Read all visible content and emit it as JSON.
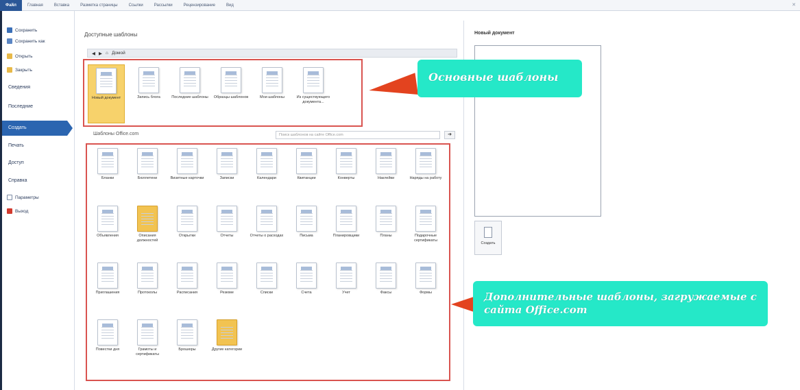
{
  "ribbon": {
    "tabs": [
      "Файл",
      "Главная",
      "Вставка",
      "Разметка страницы",
      "Ссылки",
      "Рассылки",
      "Рецензирование",
      "Вид"
    ]
  },
  "nav": {
    "save": "Сохранить",
    "save_as": "Сохранить как",
    "open": "Открыть",
    "close": "Закрыть",
    "info": "Сведения",
    "recent": "Последние",
    "create": "Создать",
    "print": "Печать",
    "share": "Доступ",
    "help": "Справка",
    "options": "Параметры",
    "exit": "Выход"
  },
  "main": {
    "title": "Доступные шаблоны",
    "home": "Домой",
    "basic_templates": [
      {
        "label": "Новый документ",
        "icon": "blank-doc-icon"
      },
      {
        "label": "Запись блога",
        "icon": "blog-icon"
      },
      {
        "label": "Последние шаблоны",
        "icon": "clock-icon"
      },
      {
        "label": "Образцы шаблонов",
        "icon": "samples-icon"
      },
      {
        "label": "Мои шаблоны",
        "icon": "person-icon"
      },
      {
        "label": "Из существующего документа...",
        "icon": "existing-doc-icon"
      }
    ],
    "online_title": "Шаблоны Office.com",
    "search_placeholder": "Поиск шаблонов на сайте Office.com",
    "online_templates": [
      "Бланки",
      "Бюллетени",
      "Визитные карточки",
      "Записки",
      "Календари",
      "Квитанции",
      "Конверты",
      "Наклейки",
      "Наряды на работу",
      "Объявления",
      "Описания должностей",
      "Открытки",
      "Отчеты",
      "Отчеты о расходах",
      "Письма",
      "Планировщики",
      "Планы",
      "Подарочные сертификаты",
      "Приглашения",
      "Протоколы",
      "Расписания",
      "Резюме",
      "Списки",
      "Счета",
      "Учет",
      "Факсы",
      "Формы",
      "Повестки дня",
      "Грамоты и сертификаты",
      "Брошюры",
      "Другие категории"
    ]
  },
  "preview": {
    "title": "Новый документ",
    "create_label": "Создать"
  },
  "callouts": {
    "basic": "Основные шаблоны",
    "online": "Дополнительные шаблоны, загружаемые с сайта Office.com"
  }
}
